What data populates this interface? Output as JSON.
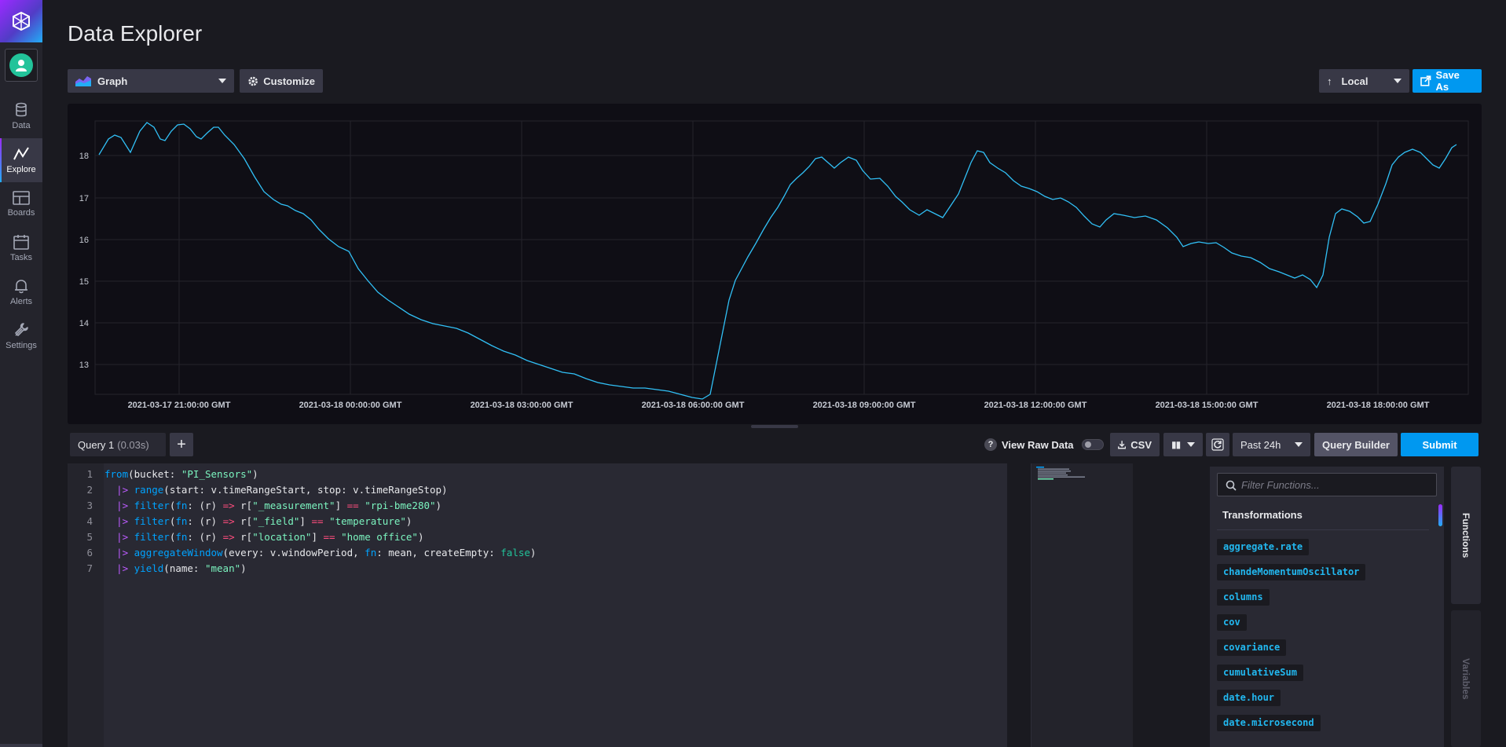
{
  "app": {
    "page_title": "Data Explorer"
  },
  "nav": {
    "items": [
      {
        "label": "Data",
        "icon": "database-icon"
      },
      {
        "label": "Explore",
        "icon": "graph-line-icon",
        "active": true
      },
      {
        "label": "Boards",
        "icon": "dashboard-grid-icon"
      },
      {
        "label": "Tasks",
        "icon": "calendar-icon"
      },
      {
        "label": "Alerts",
        "icon": "bell-icon"
      },
      {
        "label": "Settings",
        "icon": "wrench-icon"
      }
    ]
  },
  "toolbar": {
    "view_type": "Graph",
    "customize_label": "Customize",
    "timezone": "Local",
    "save_as_label": "Save As"
  },
  "graph": {
    "line_color": "#31c0f6",
    "y_ticks": [
      "13",
      "14",
      "15",
      "16",
      "17",
      "18"
    ],
    "x_ticks": [
      "2021-03-17 21:00:00 GMT",
      "2021-03-18 00:00:00 GMT",
      "2021-03-18 03:00:00 GMT",
      "2021-03-18 06:00:00 GMT",
      "2021-03-18 09:00:00 GMT",
      "2021-03-18 12:00:00 GMT",
      "2021-03-18 15:00:00 GMT",
      "2021-03-18 18:00:00 GMT"
    ]
  },
  "query_bar": {
    "tab_label": "Query 1",
    "tab_time": "(0.03s)",
    "add_label": "+",
    "raw_data_label": "View Raw Data",
    "raw_data_on": false,
    "csv_label": "CSV",
    "time_range": "Past 24h",
    "query_builder_label": "Query Builder",
    "submit_label": "Submit"
  },
  "editor": {
    "line_numbers": [
      "1",
      "2",
      "3",
      "4",
      "5",
      "6",
      "7"
    ]
  },
  "functions_panel": {
    "filter_placeholder": "Filter Functions...",
    "category": "Transformations",
    "items": [
      "aggregate.rate",
      "chandeMomentumOscillator",
      "columns",
      "cov",
      "covariance",
      "cumulativeSum",
      "date.hour",
      "date.microsecond"
    ],
    "tabs": [
      "Functions",
      "Variables"
    ]
  }
}
